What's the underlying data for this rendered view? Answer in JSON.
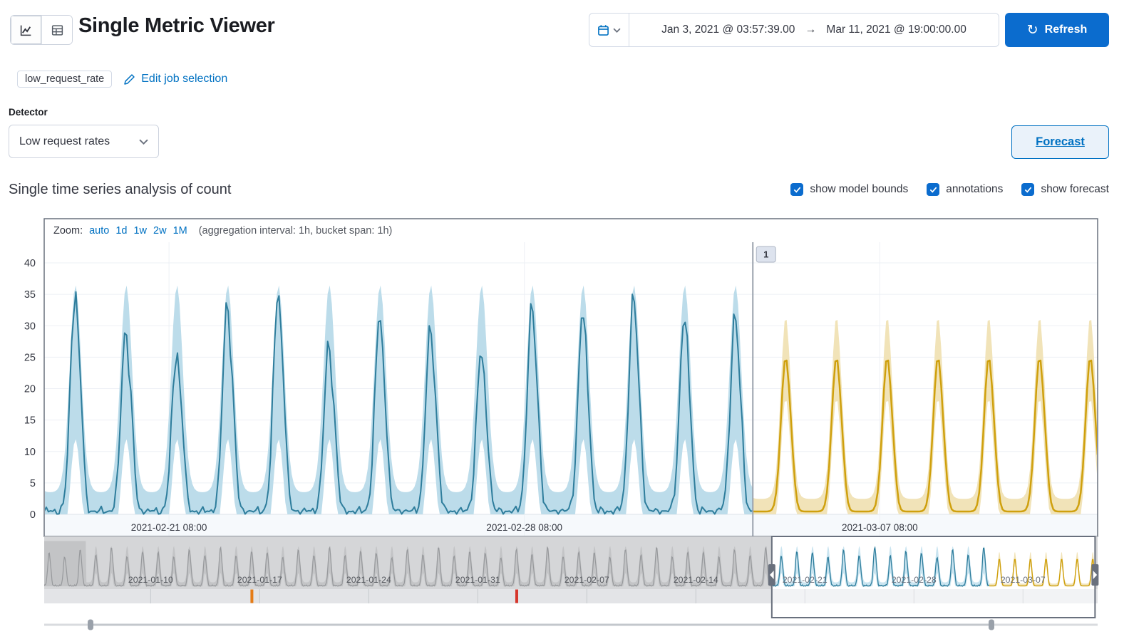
{
  "colors": {
    "primary": "#0b6cce",
    "link": "#0071c2",
    "text": "#343741",
    "chart_frame": "#69707d",
    "observed_line": "#2e7d9c",
    "observed_band": "#bcdcea",
    "forecast_line": "#cfa00d",
    "forecast_band": "#f1e3b8",
    "annotation_line": "#9aa2ad",
    "annotation_chip_bg": "#dde3ee",
    "anomaly_major": "#e57c17",
    "anomaly_critical": "#d6352b",
    "context_gray_line": "#97999c",
    "context_gray_band": "#c3c4c6",
    "context_bg": "#d5d6d8",
    "swimlane_bg": "#e3e4e7"
  },
  "header": {
    "title": "Single Metric Viewer",
    "view_toggle": [
      "chart",
      "table"
    ],
    "time_range": {
      "start": "Jan 3, 2021 @ 03:57:39.00",
      "arrow": "→",
      "end": "Mar 11, 2021 @ 19:00:00.00"
    },
    "refresh": {
      "label": "Refresh",
      "icon_glyph": "↻"
    }
  },
  "job_row": {
    "badge": "low_request_rate",
    "edit_link": "Edit job selection"
  },
  "detector": {
    "label": "Detector",
    "selected": "Low request rates"
  },
  "forecast_button_label": "Forecast",
  "analysis": {
    "heading": "Single time series analysis of count",
    "toggles": [
      {
        "label": "show model bounds",
        "checked": true
      },
      {
        "label": "annotations",
        "checked": true
      },
      {
        "label": "show forecast",
        "checked": true
      }
    ]
  },
  "zoom_bar": {
    "label": "Zoom:",
    "options": [
      "auto",
      "1d",
      "1w",
      "2w",
      "1M"
    ],
    "note": "(aggregation interval: 1h, bucket span: 1h)"
  },
  "chart_data": {
    "type": "line",
    "title": "Single time series analysis of count",
    "series_name": "count",
    "ylim": [
      0,
      40
    ],
    "y_ticks": [
      0,
      5,
      10,
      15,
      20,
      25,
      30,
      35,
      40
    ],
    "focus": {
      "x_domain": [
        "2021-02-18 21:00",
        "2021-03-11 15:00"
      ],
      "x_ticks": [
        {
          "label": "2021-02-21 08:00",
          "time": "2021-02-21 08:00"
        },
        {
          "label": "2021-02-28 08:00",
          "time": "2021-02-28 08:00"
        },
        {
          "label": "2021-03-07 08:00",
          "time": "2021-03-07 08:00"
        }
      ],
      "bucket_span": "1h",
      "observed": {
        "peak_hour_utc": 11.5,
        "trough_value": 0.5,
        "daily_peaks": [
          {
            "date": "2021-02-19",
            "peak": 35
          },
          {
            "date": "2021-02-20",
            "peak": 29
          },
          {
            "date": "2021-02-21",
            "peak": 25.5
          },
          {
            "date": "2021-02-22",
            "peak": 33
          },
          {
            "date": "2021-02-23",
            "peak": 35
          },
          {
            "date": "2021-02-24",
            "peak": 26.5
          },
          {
            "date": "2021-02-25",
            "peak": 31
          },
          {
            "date": "2021-02-26",
            "peak": 29
          },
          {
            "date": "2021-02-27",
            "peak": 25
          },
          {
            "date": "2021-02-28",
            "peak": 32.5
          },
          {
            "date": "2021-03-01",
            "peak": 31.5
          },
          {
            "date": "2021-03-02",
            "peak": 34
          },
          {
            "date": "2021-03-03",
            "peak": 31
          },
          {
            "date": "2021-03-04",
            "peak": 31
          }
        ]
      },
      "model_bounds": {
        "peak_upper": 36.5,
        "peak_lower": 12,
        "trough_upper": 3.5,
        "trough_lower": 0
      },
      "forecast": {
        "start": "2021-03-04 20:00",
        "daily_peak": 24.5,
        "bounds_peak_upper": 30,
        "bounds_peak_lower": 17
      },
      "annotations": [
        {
          "label": "1",
          "time": "2021-03-04 20:00"
        }
      ]
    },
    "context": {
      "x_domain": [
        "2021-01-03 04:00",
        "2021-03-11 19:00"
      ],
      "x_ticks": [
        "2021-01-10",
        "2021-01-17",
        "2021-01-24",
        "2021-01-31",
        "2021-02-07",
        "2021-02-14",
        "2021-02-21",
        "2021-02-28",
        "2021-03-07"
      ],
      "selection": [
        "2021-02-18 21:00",
        "2021-03-11 15:00"
      ],
      "daily_peak_pattern": [
        30,
        26,
        33,
        28,
        35,
        27,
        31
      ],
      "anomaly_markers": [
        {
          "time": "2021-01-16 12:00",
          "severity": "major"
        },
        {
          "time": "2021-02-02 12:00",
          "severity": "critical"
        }
      ]
    }
  }
}
